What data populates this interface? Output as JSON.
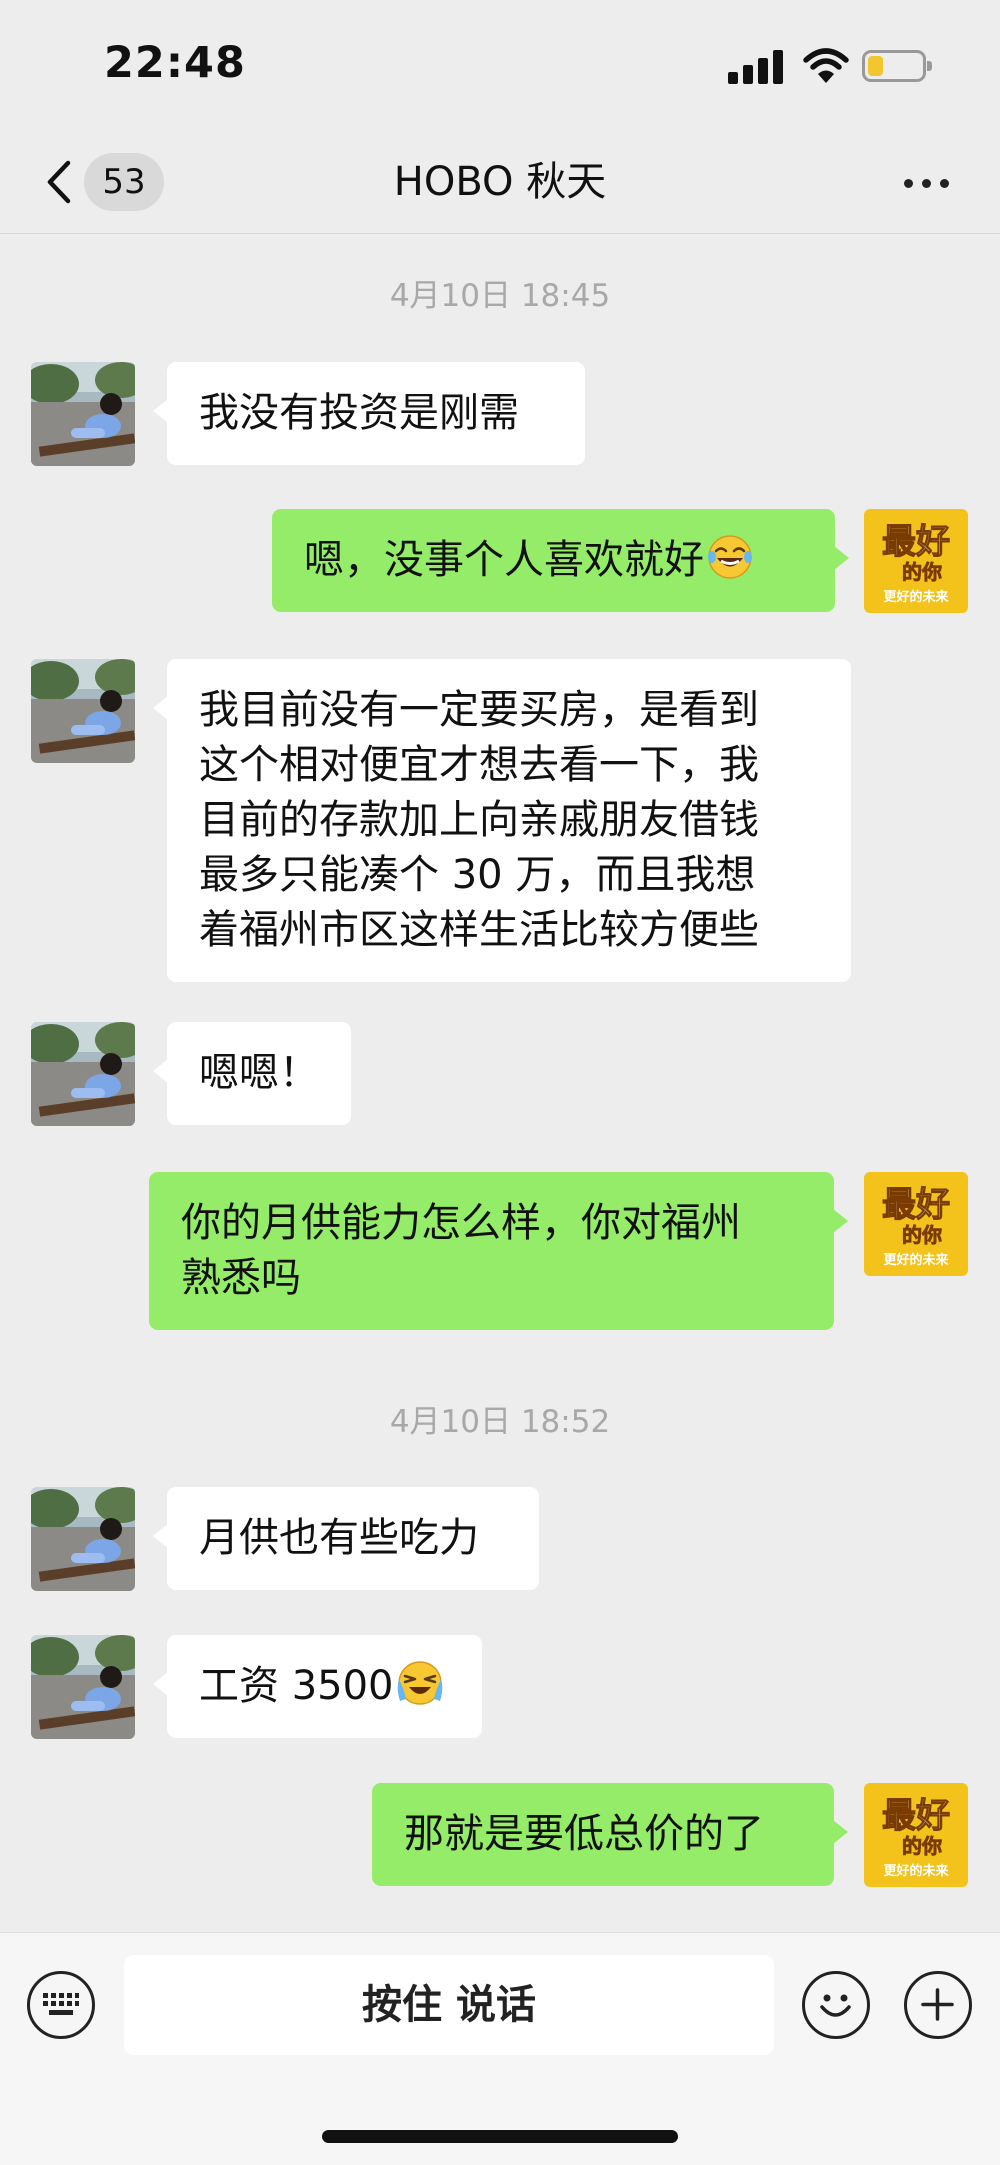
{
  "status_bar": {
    "time": "22:48"
  },
  "header": {
    "back_count": "53",
    "title": "HOBO 秋天"
  },
  "messages": [
    {
      "type": "timestamp",
      "text": "4月10日 18:45"
    },
    {
      "type": "incoming",
      "lines": [
        "我没有投资是刚需"
      ]
    },
    {
      "type": "outgoing",
      "lines": [
        "嗯，没事个人喜欢就好"
      ],
      "emoji": "laughing-tears-emoji"
    },
    {
      "type": "incoming",
      "lines": [
        "我目前没有一定要买房，是看到",
        "这个相对便宜才想去看一下，我",
        "目前的存款加上向亲戚朋友借钱",
        "最多只能凑个 30 万，而且我想",
        "着福州市区这样生活比较方便些"
      ]
    },
    {
      "type": "incoming",
      "lines": [
        "嗯嗯！"
      ]
    },
    {
      "type": "outgoing",
      "lines": [
        "你的月供能力怎么样，你对福州",
        "熟悉吗"
      ]
    },
    {
      "type": "timestamp",
      "text": "4月10日 18:52"
    },
    {
      "type": "incoming",
      "lines": [
        "月供也有些吃力"
      ]
    },
    {
      "type": "incoming",
      "lines": [
        "工资 3500"
      ],
      "emoji": "crying-laughing-emoji"
    },
    {
      "type": "outgoing",
      "lines": [
        "那就是要低总价的了"
      ]
    }
  ],
  "avatar_self": {
    "top_text": "最好",
    "mid_text": "的你",
    "bottom_text": "更好的未来",
    "bg": "#f3c21b"
  },
  "avatar_other": {
    "icon": "photo-avatar"
  },
  "input_bar": {
    "voice_label": "按住 说话"
  },
  "colors": {
    "bg": "#ededed",
    "outgoing": "#95ec69",
    "incoming": "#ffffff"
  }
}
